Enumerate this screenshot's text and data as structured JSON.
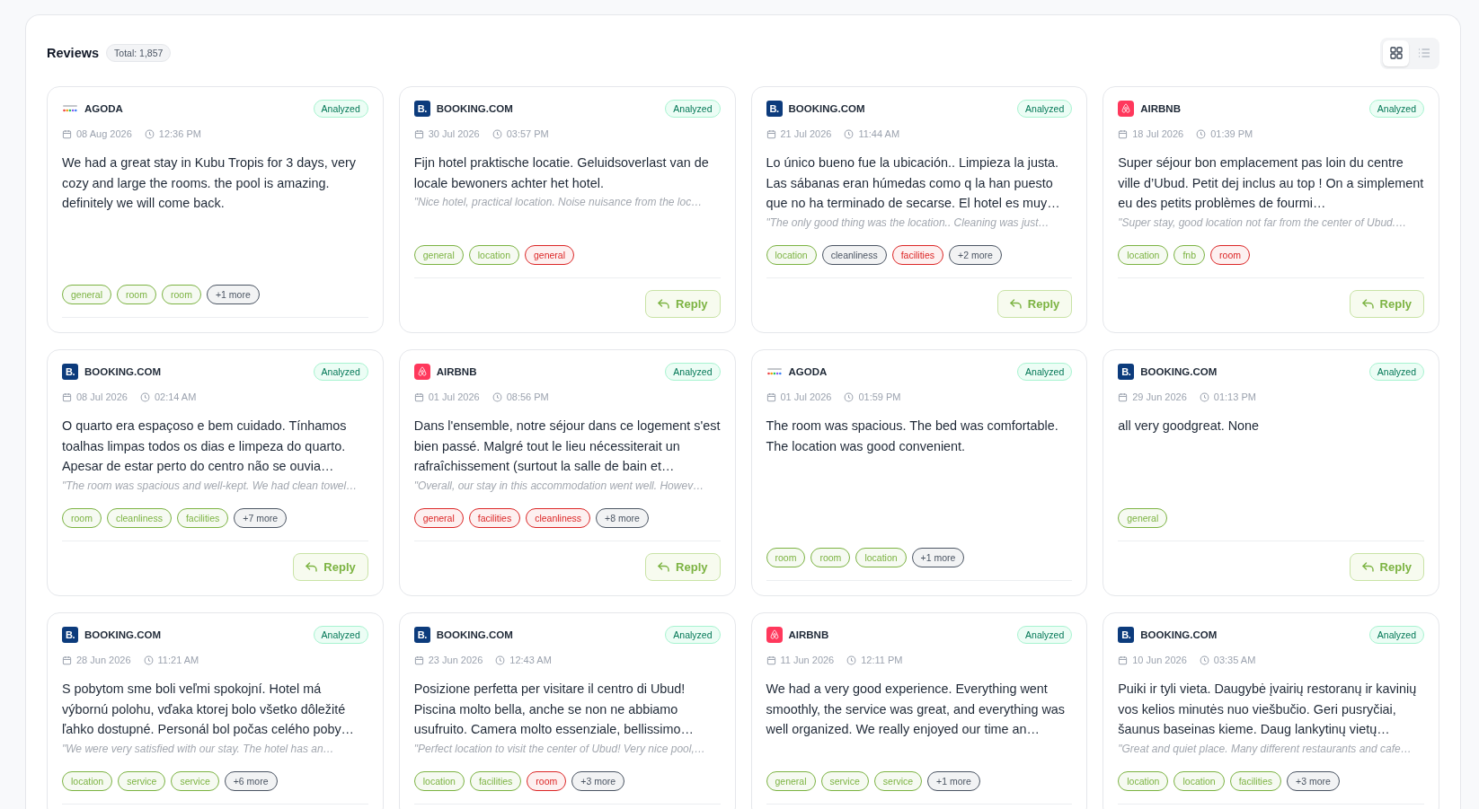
{
  "header": {
    "title": "Reviews",
    "total": "Total: 1,857"
  },
  "view_toggle": [
    {
      "kind": "grid",
      "selected": true
    },
    {
      "kind": "list",
      "selected": false
    }
  ],
  "reviews": [
    {
      "source": {
        "kind": "agoda",
        "name": "AGODA"
      },
      "status": "Analyzed",
      "date": "08 Aug 2026",
      "time": "12:36 PM",
      "text": "We had a great stay in Kubu Tropis for 3 days, very cozy and large the rooms. the pool is amazing. definitely we will come back.",
      "tags": [
        {
          "label": "general",
          "color": "#7cb342"
        },
        {
          "label": "room",
          "color": "#7cb342"
        },
        {
          "label": "room",
          "color": "#7cb342"
        },
        {
          "label": "+1 more",
          "color": "#4b5563"
        }
      ]
    },
    {
      "source": {
        "kind": "booking",
        "name": "BOOKING.COM",
        "logo_text": "B."
      },
      "status": "Analyzed",
      "date": "30 Jul 2026",
      "time": "03:57 PM",
      "text": "Fijn hotel praktische locatie. Geluidsoverlast van de locale bewoners achter het hotel.",
      "translation": "\"Nice hotel, practical location. Noise nuisance from the loc…",
      "tags": [
        {
          "label": "general",
          "color": "#7cb342"
        },
        {
          "label": "location",
          "color": "#7cb342"
        },
        {
          "label": "general",
          "color": "#dc2626"
        }
      ],
      "reply": "Reply"
    },
    {
      "source": {
        "kind": "booking",
        "name": "BOOKING.COM",
        "logo_text": "B."
      },
      "status": "Analyzed",
      "date": "21 Jul 2026",
      "time": "11:44 AM",
      "text": "Lo único bueno fue la ubicación.. Limpieza la justa. Las sábanas eran húmedas como q la han puesto que no ha terminado de secarse. El hotel es muy…",
      "translation": "\"The only good thing was the location.. Cleaning was just…",
      "tags": [
        {
          "label": "location",
          "color": "#7cb342"
        },
        {
          "label": "cleanliness",
          "color": "#4b5563"
        },
        {
          "label": "facilities",
          "color": "#dc2626"
        },
        {
          "label": "+2 more",
          "color": "#4b5563"
        }
      ],
      "reply": "Reply"
    },
    {
      "source": {
        "kind": "airbnb",
        "name": "AIRBNB"
      },
      "status": "Analyzed",
      "date": "18 Jul 2026",
      "time": "01:39 PM",
      "text": "Super séjour bon emplacement pas loin du centre ville d’Ubud. Petit dej inclus au top ! On a simplement eu des petits problèmes de fourmi…",
      "translation": "\"Super stay, good location not far from the center of Ubud.…",
      "tags": [
        {
          "label": "location",
          "color": "#7cb342"
        },
        {
          "label": "fnb",
          "color": "#7cb342"
        },
        {
          "label": "room",
          "color": "#dc2626"
        }
      ],
      "reply": "Reply"
    },
    {
      "source": {
        "kind": "booking",
        "name": "BOOKING.COM",
        "logo_text": "B."
      },
      "status": "Analyzed",
      "date": "08 Jul 2026",
      "time": "02:14 AM",
      "text": "O quarto era espaçoso e bem cuidado. Tínhamos toalhas limpas todos os dias e limpeza do quarto. Apesar de estar perto do centro não se ouvia…",
      "translation": "\"The room was spacious and well-kept. We had clean towel…",
      "tags": [
        {
          "label": "room",
          "color": "#7cb342"
        },
        {
          "label": "cleanliness",
          "color": "#7cb342"
        },
        {
          "label": "facilities",
          "color": "#7cb342"
        },
        {
          "label": "+7 more",
          "color": "#4b5563"
        }
      ],
      "reply": "Reply"
    },
    {
      "source": {
        "kind": "airbnb",
        "name": "AIRBNB"
      },
      "status": "Analyzed",
      "date": "01 Jul 2026",
      "time": "08:56 PM",
      "text": "Dans l'ensemble, notre séjour dans ce logement s'est bien passé. Malgré tout le lieu nécessiterait un rafraîchissement (surtout la salle de bain et…",
      "translation": "\"Overall, our stay in this accommodation went well. Howev…",
      "tags": [
        {
          "label": "general",
          "color": "#dc2626"
        },
        {
          "label": "facilities",
          "color": "#dc2626"
        },
        {
          "label": "cleanliness",
          "color": "#dc2626"
        },
        {
          "label": "+8 more",
          "color": "#4b5563"
        }
      ],
      "reply": "Reply"
    },
    {
      "source": {
        "kind": "agoda",
        "name": "AGODA"
      },
      "status": "Analyzed",
      "date": "01 Jul 2026",
      "time": "01:59 PM",
      "text": "The room was spacious. The bed was comfortable. The location was good convenient.",
      "tags": [
        {
          "label": "room",
          "color": "#7cb342"
        },
        {
          "label": "room",
          "color": "#7cb342"
        },
        {
          "label": "location",
          "color": "#7cb342"
        },
        {
          "label": "+1 more",
          "color": "#4b5563"
        }
      ]
    },
    {
      "source": {
        "kind": "booking",
        "name": "BOOKING.COM",
        "logo_text": "B."
      },
      "status": "Analyzed",
      "date": "29 Jun 2026",
      "time": "01:13 PM",
      "text": "all very goodgreat. None",
      "tags": [
        {
          "label": "general",
          "color": "#7cb342"
        }
      ],
      "reply": "Reply"
    },
    {
      "source": {
        "kind": "booking",
        "name": "BOOKING.COM",
        "logo_text": "B."
      },
      "status": "Analyzed",
      "date": "28 Jun 2026",
      "time": "11:21 AM",
      "text": "S pobytom sme boli veľmi spokojní. Hotel má výbornú polohu, vďaka ktorej bolo všetko dôležité ľahko dostupné. Personál bol počas celého poby…",
      "translation": "\"We were very satisfied with our stay. The hotel has an…",
      "tags": [
        {
          "label": "location",
          "color": "#7cb342"
        },
        {
          "label": "service",
          "color": "#7cb342"
        },
        {
          "label": "service",
          "color": "#7cb342"
        },
        {
          "label": "+6 more",
          "color": "#4b5563"
        }
      ]
    },
    {
      "source": {
        "kind": "booking",
        "name": "BOOKING.COM",
        "logo_text": "B."
      },
      "status": "Analyzed",
      "date": "23 Jun 2026",
      "time": "12:43 AM",
      "text": "Posizione perfetta per visitare il centro di Ubud! Piscina molto bella, anche se non ne abbiamo usufruito. Camera molto essenziale, bellissimo…",
      "translation": "\"Perfect location to visit the center of Ubud! Very nice pool,…",
      "tags": [
        {
          "label": "location",
          "color": "#7cb342"
        },
        {
          "label": "facilities",
          "color": "#7cb342"
        },
        {
          "label": "room",
          "color": "#dc2626"
        },
        {
          "label": "+3 more",
          "color": "#4b5563"
        }
      ]
    },
    {
      "source": {
        "kind": "airbnb",
        "name": "AIRBNB"
      },
      "status": "Analyzed",
      "date": "11 Jun 2026",
      "time": "12:11 PM",
      "text": "We had a very good experience. Everything went smoothly, the service was great, and everything was well organized. We really enjoyed our time an…",
      "tags": [
        {
          "label": "general",
          "color": "#7cb342"
        },
        {
          "label": "service",
          "color": "#7cb342"
        },
        {
          "label": "service",
          "color": "#7cb342"
        },
        {
          "label": "+1 more",
          "color": "#4b5563"
        }
      ]
    },
    {
      "source": {
        "kind": "booking",
        "name": "BOOKING.COM",
        "logo_text": "B."
      },
      "status": "Analyzed",
      "date": "10 Jun 2026",
      "time": "03:35 AM",
      "text": "Puiki ir tyli vieta. Daugybė įvairių restoranų ir kavinių vos kelios minutės nuo viešbučio. Geri pusryčiai, šaunus baseinas kieme. Daug lankytinų vietų…",
      "translation": "\"Great and quiet place. Many different restaurants and cafe…",
      "tags": [
        {
          "label": "location",
          "color": "#7cb342"
        },
        {
          "label": "location",
          "color": "#7cb342"
        },
        {
          "label": "facilities",
          "color": "#7cb342"
        },
        {
          "label": "+3 more",
          "color": "#4b5563"
        }
      ]
    }
  ]
}
